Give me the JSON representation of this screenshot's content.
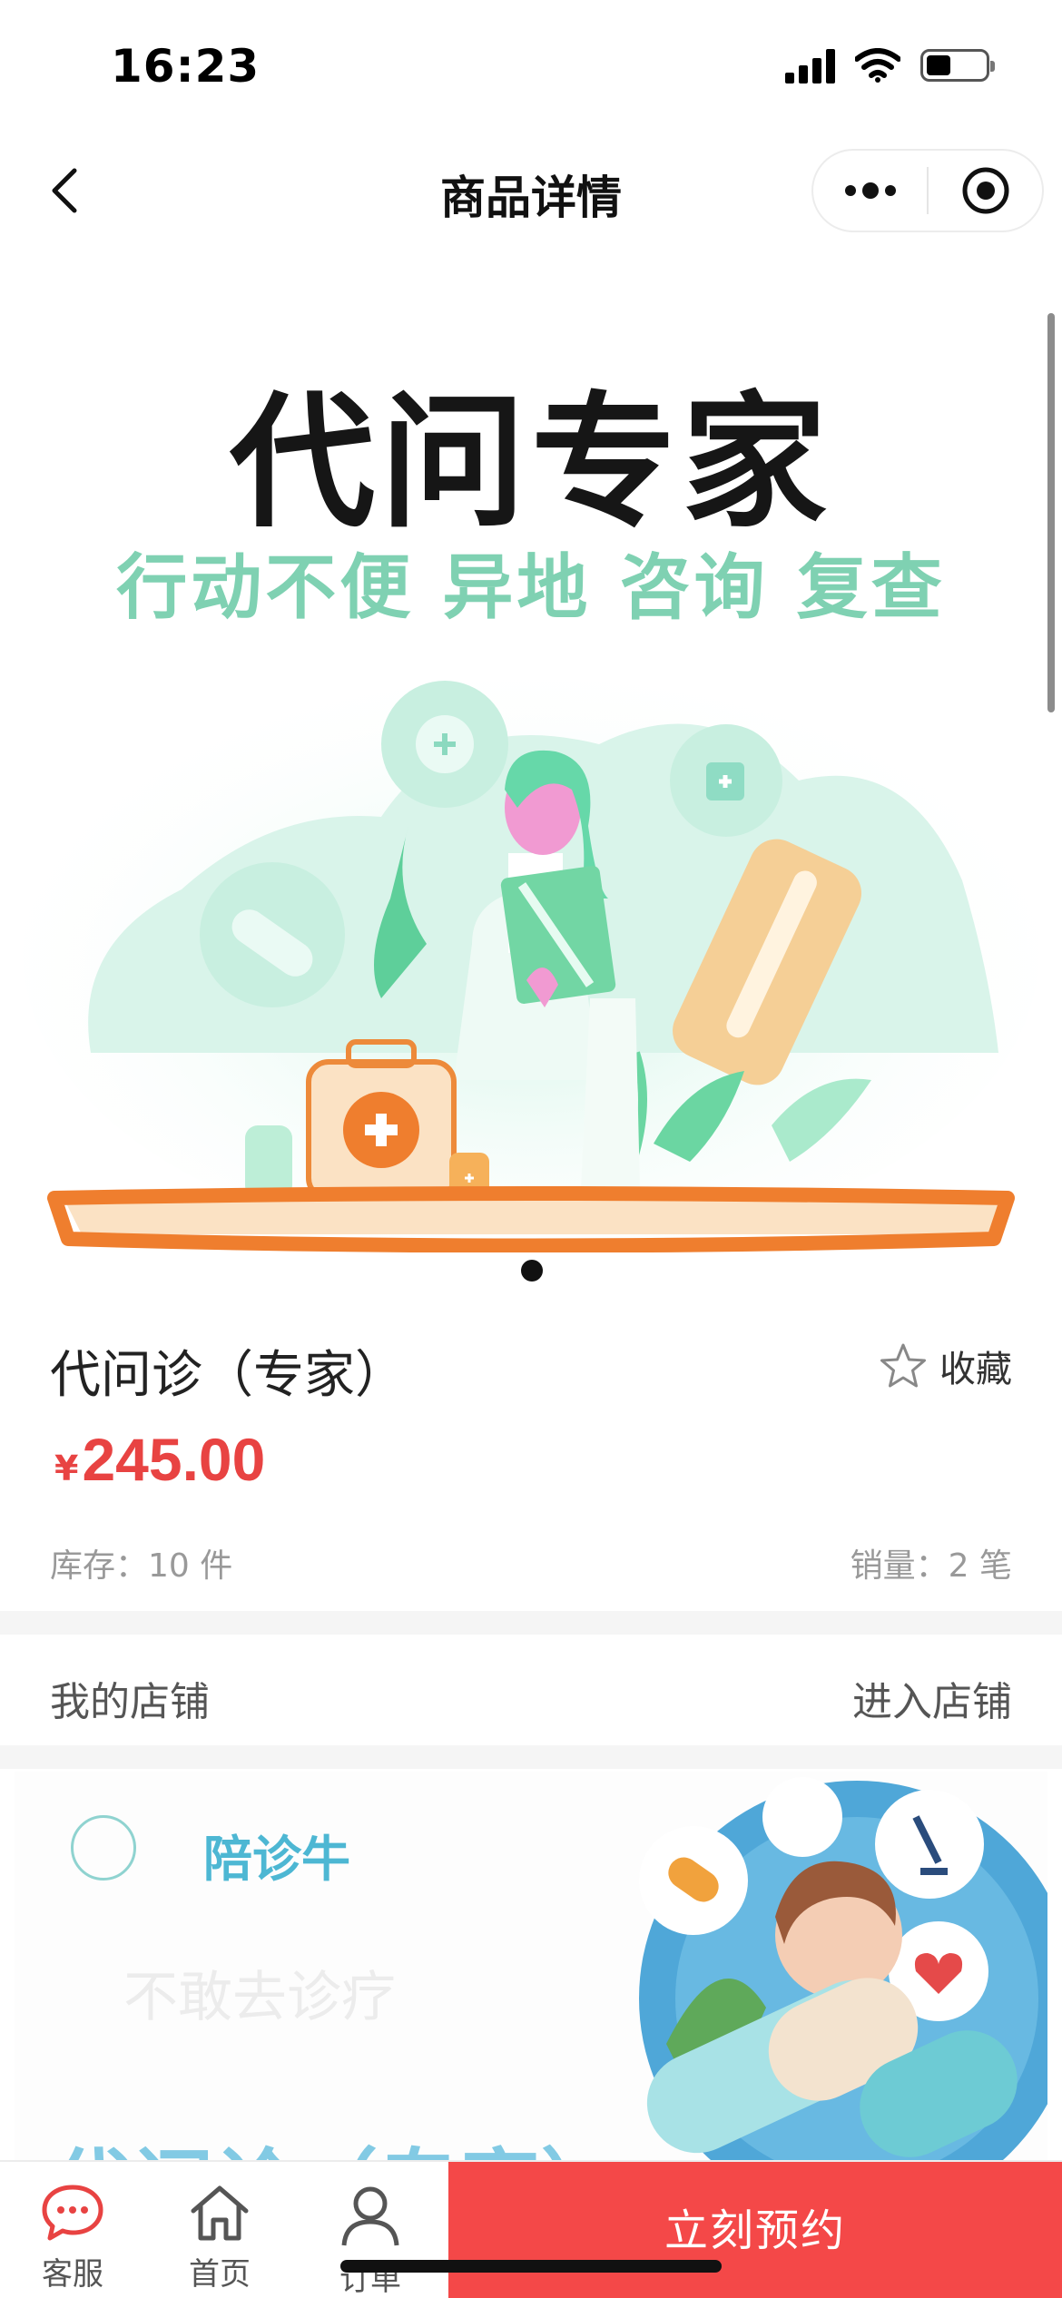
{
  "status_bar": {
    "time": "16:23"
  },
  "nav": {
    "title": "商品详情"
  },
  "banner": {
    "title": "代问专家",
    "subtitle": "行动不便 异地 咨询 复查"
  },
  "product": {
    "name": "代问诊（专家）",
    "favorite_label": "收藏",
    "currency": "¥",
    "price": "245.00",
    "stock": "库存：10 件",
    "sales": "销量：2 笔"
  },
  "shop": {
    "label": "我的店铺",
    "enter": "进入店铺",
    "name": "陪诊牛",
    "faded_text": "不敢去诊疗",
    "big_text": "代问诊（专家）"
  },
  "bottom_bar": {
    "service_label": "客服",
    "home_label": "首页",
    "order_label": "订单",
    "book_button": "立刻预约"
  },
  "colors": {
    "accent_red": "#f44848",
    "price_red": "#e84342",
    "mint": "#7fd1b2",
    "shop_blue": "#4db7d3"
  },
  "icons": [
    "back-arrow-icon",
    "more-dots-icon",
    "close-target-icon",
    "star-icon",
    "chat-bubble-icon",
    "home-icon",
    "person-icon"
  ]
}
